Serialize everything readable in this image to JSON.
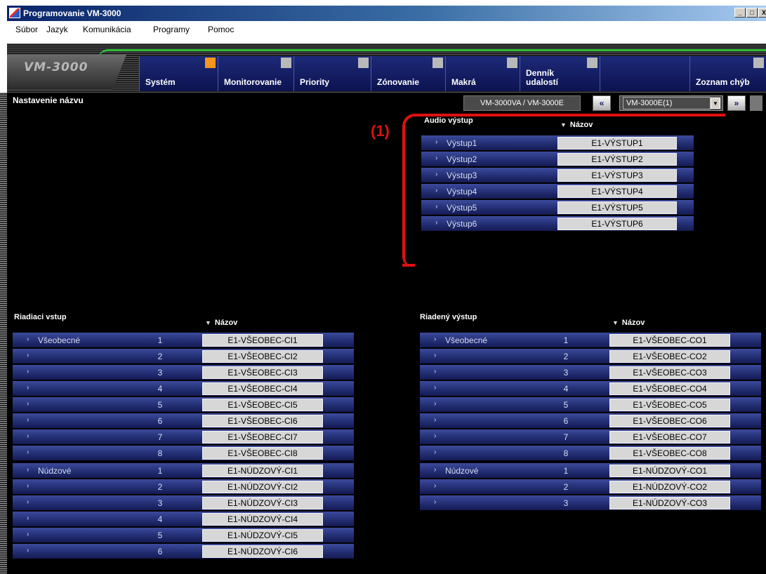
{
  "window": {
    "title": "Programovanie VM-3000",
    "controls": [
      "_",
      "□",
      "X"
    ]
  },
  "menu": [
    "Súbor",
    "Jazyk",
    "Komunikácia",
    "Programy",
    "Pomoc"
  ],
  "logo": "VM-3000",
  "tabs": [
    {
      "label": "Systém",
      "active": true
    },
    {
      "label": "Monitorovanie",
      "active": false
    },
    {
      "label": "Priority",
      "active": false
    },
    {
      "label": "Zónovanie",
      "active": false
    },
    {
      "label": "Makrá",
      "active": false
    },
    {
      "label": "Denník udalostí",
      "active": false
    },
    {
      "label": "",
      "active": false
    },
    {
      "label": "Zoznam chýb",
      "active": false
    }
  ],
  "section_title": "Nastavenie názvu",
  "model_button": "VM-3000VA / VM-3000E",
  "nav": {
    "prev": "«",
    "next": "»"
  },
  "unit_select": "VM-3000E(1)",
  "annotation": "(1)",
  "audio": {
    "title": "Audio výstup",
    "name_header": "Názov",
    "rows": [
      {
        "label": "Výstup1",
        "value": "E1-VÝSTUP1"
      },
      {
        "label": "Výstup2",
        "value": "E1-VÝSTUP2"
      },
      {
        "label": "Výstup3",
        "value": "E1-VÝSTUP3"
      },
      {
        "label": "Výstup4",
        "value": "E1-VÝSTUP4"
      },
      {
        "label": "Výstup5",
        "value": "E1-VÝSTUP5"
      },
      {
        "label": "Výstup6",
        "value": "E1-VÝSTUP6"
      }
    ]
  },
  "control_in": {
    "title": "Riadiaci vstup",
    "name_header": "Názov",
    "rows": [
      {
        "group": "Všeobecné",
        "num": "1",
        "value": "E1-VŠEOBEC-CI1"
      },
      {
        "group": "",
        "num": "2",
        "value": "E1-VŠEOBEC-CI2"
      },
      {
        "group": "",
        "num": "3",
        "value": "E1-VŠEOBEC-CI3"
      },
      {
        "group": "",
        "num": "4",
        "value": "E1-VŠEOBEC-CI4"
      },
      {
        "group": "",
        "num": "5",
        "value": "E1-VŠEOBEC-CI5"
      },
      {
        "group": "",
        "num": "6",
        "value": "E1-VŠEOBEC-CI6"
      },
      {
        "group": "",
        "num": "7",
        "value": "E1-VŠEOBEC-CI7"
      },
      {
        "group": "",
        "num": "8",
        "value": "E1-VŠEOBEC-CI8"
      },
      {
        "group": "Núdzové",
        "num": "1",
        "value": "E1-NÚDZOVÝ-CI1"
      },
      {
        "group": "",
        "num": "2",
        "value": "E1-NÚDZOVÝ-CI2"
      },
      {
        "group": "",
        "num": "3",
        "value": "E1-NÚDZOVÝ-CI3"
      },
      {
        "group": "",
        "num": "4",
        "value": "E1-NÚDZOVÝ-CI4"
      },
      {
        "group": "",
        "num": "5",
        "value": "E1-NÚDZOVÝ-CI5"
      },
      {
        "group": "",
        "num": "6",
        "value": "E1-NÚDZOVÝ-CI6"
      }
    ]
  },
  "control_out": {
    "title": "Riadený výstup",
    "name_header": "Názov",
    "rows": [
      {
        "group": "Všeobecné",
        "num": "1",
        "value": "E1-VŠEOBEC-CO1"
      },
      {
        "group": "",
        "num": "2",
        "value": "E1-VŠEOBEC-CO2"
      },
      {
        "group": "",
        "num": "3",
        "value": "E1-VŠEOBEC-CO3"
      },
      {
        "group": "",
        "num": "4",
        "value": "E1-VŠEOBEC-CO4"
      },
      {
        "group": "",
        "num": "5",
        "value": "E1-VŠEOBEC-CO5"
      },
      {
        "group": "",
        "num": "6",
        "value": "E1-VŠEOBEC-CO6"
      },
      {
        "group": "",
        "num": "7",
        "value": "E1-VŠEOBEC-CO7"
      },
      {
        "group": "",
        "num": "8",
        "value": "E1-VŠEOBEC-CO8"
      },
      {
        "group": "Núdzové",
        "num": "1",
        "value": "E1-NÚDZOVÝ-CO1"
      },
      {
        "group": "",
        "num": "2",
        "value": "E1-NÚDZOVÝ-CO2"
      },
      {
        "group": "",
        "num": "3",
        "value": "E1-NÚDZOVÝ-CO3"
      }
    ]
  },
  "colors": {
    "accent_orange": "#f5961e",
    "tab_blue": "#0c1350",
    "row_blue": "#27337a",
    "annotation_red": "#e01010",
    "green_accent": "#2fbf3a"
  },
  "icons": {
    "expand": "chevron-right-icon",
    "sort": "triangle-down-icon",
    "dropdown": "chevron-down-icon"
  }
}
